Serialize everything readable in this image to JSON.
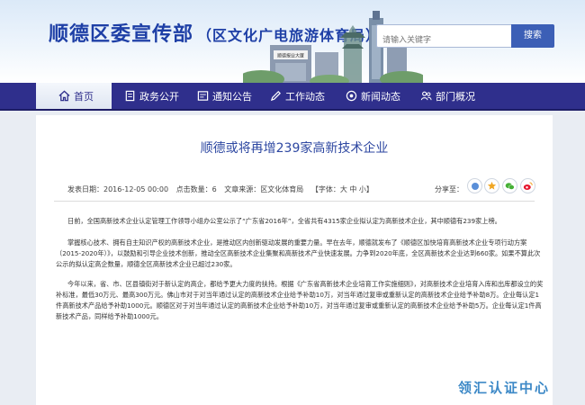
{
  "header": {
    "title": "顺德区委宣传部",
    "subtitle": "（区文化广电旅游体育局）",
    "search_placeholder": "请输入关键字",
    "search_button": "搜索",
    "building_sign": "顺德报业大厦"
  },
  "nav": {
    "items": [
      {
        "label": "首页",
        "icon": "home-icon"
      },
      {
        "label": "政务公开",
        "icon": "document-icon"
      },
      {
        "label": "通知公告",
        "icon": "notice-icon"
      },
      {
        "label": "工作动态",
        "icon": "pencil-icon"
      },
      {
        "label": "新闻动态",
        "icon": "news-icon"
      },
      {
        "label": "部门概况",
        "icon": "people-icon"
      }
    ]
  },
  "article": {
    "title": "顺德或将再增239家高新技术企业",
    "meta": {
      "date": "发表日期：2016-12-05 00:00",
      "views": "点击数量：6",
      "source": "文章来源：区文化体育局",
      "font": "【字体：大 中 小】"
    },
    "share_label": "分享至：",
    "paragraphs": [
      "日前，全国高新技术企业认定管理工作领导小组办公室公示了“广东省2016年”，全省共有4315家企业拟认定为高新技术企业，其中顺德有239家上榜。",
      "掌握核心技术、拥有自主知识产权的高新技术企业，是推动区内创新驱动发展的重要力量。早在去年，顺德就发布了《顺德区加快培育高新技术企业专项行动方案（2015-2020年）》，以鼓励和引导企业技术创新，推动全区高新技术企业集聚和高新技术产业快速发展。力争到2020年底，全区高新技术企业达到660家。如果不算此次公示的拟认定高企数量，顺德全区高新技术企业已超过230家。",
      "今年以来，省、市、区县镇街对于新认定的高企，都给予更大力度的扶持。根据《广东省高新技术企业培育工作实施细则》，对高新技术企业培育入库和出库都设立的奖补标准，最低30万元、最高300万元。佛山市对于对当年通过认定的高新技术企业给予补助10万，对当年通过复审或重新认定的高新技术企业给予补助8万。企业每认定1件高新技术产品给予补助1000元。顺德区对于对当年通过认定的高新技术企业给予补助10万，对当年通过复审或重新认定的高新技术企业给予补助5万。企业每认定1件高新技术产品，同样给予补助1000元。"
    ]
  },
  "watermark": "领汇认证中心",
  "colors": {
    "nav_bg": "#2f2f8c",
    "title_blue": "#1e3fa6",
    "article_title": "#2d47a1",
    "search_button": "#3c5fb6",
    "watermark": "#3d89c7"
  }
}
